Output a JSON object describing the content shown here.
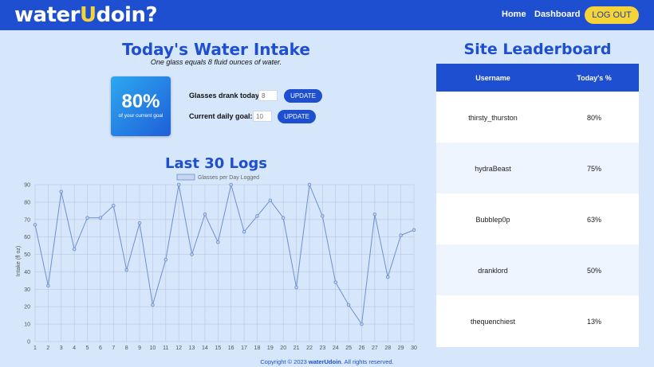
{
  "nav": {
    "brand_part1": "water",
    "brand_part2": "U",
    "brand_part3": "doin?",
    "home": "Home",
    "dashboard": "Dashboard",
    "logout": "LOG OUT"
  },
  "intake": {
    "title": "Today's Water Intake",
    "subtitle": "One glass equals 8 fluid ounces of water.",
    "goal_percent": "80%",
    "goal_caption": "of your current goal",
    "glasses_label": "Glasses drank today:",
    "glasses_placeholder": "8",
    "goal_label": "Current daily goal:",
    "goal_placeholder": "10",
    "update_label": "UPDATE"
  },
  "logs": {
    "title": "Last 30 Logs"
  },
  "chart_data": {
    "type": "line",
    "legend": "Glasses per Day Logged",
    "ylabel": "Intake (fl oz)",
    "xlabel": "",
    "x": [
      1,
      2,
      3,
      4,
      5,
      6,
      7,
      8,
      9,
      10,
      11,
      12,
      13,
      14,
      15,
      16,
      17,
      18,
      19,
      20,
      21,
      22,
      23,
      24,
      25,
      26,
      27,
      28,
      29,
      30
    ],
    "values": [
      67,
      32,
      86,
      53,
      71,
      71,
      78,
      41,
      68,
      21,
      47,
      90,
      50,
      73,
      57,
      90,
      63,
      72,
      81,
      71,
      31,
      90,
      72,
      34,
      21,
      10,
      73,
      37,
      61,
      64
    ],
    "ylim": [
      0,
      90
    ],
    "yticks": [
      0,
      10,
      20,
      30,
      40,
      50,
      60,
      70,
      80,
      90
    ],
    "grid": true,
    "legend_position": "top",
    "line_color": "#6f8fd0",
    "fill_color": "#c7d6f0"
  },
  "leaderboard": {
    "title": "Site Leaderboard",
    "col_user": "Username",
    "col_pct": "Today's %",
    "rows": [
      {
        "user": "thirsty_thurston",
        "pct": "80%"
      },
      {
        "user": "hydraBeast",
        "pct": "75%"
      },
      {
        "user": "Bubblep0p",
        "pct": "63%"
      },
      {
        "user": "dranklord",
        "pct": "50%"
      },
      {
        "user": "thequenchiest",
        "pct": "13%"
      }
    ]
  },
  "footer": {
    "prefix": "Copyright © 2023 ",
    "brand": "waterUdoin",
    "suffix": ". All rights reserved."
  },
  "colors": {
    "primary": "#1f4fd1",
    "accent": "#f5d43a",
    "background": "#d6e6fb",
    "row_alt": "#eef5fe"
  }
}
